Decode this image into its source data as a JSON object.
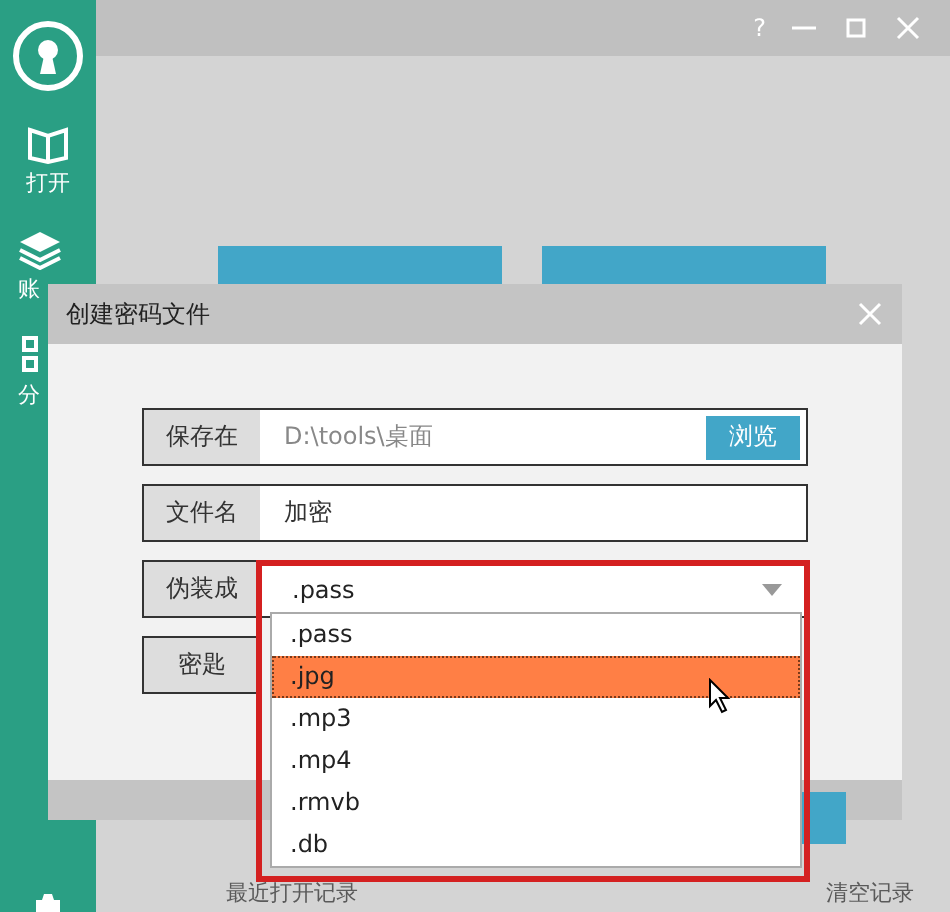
{
  "sidebar": {
    "items": [
      {
        "label": "打开"
      },
      {
        "label": "账"
      },
      {
        "label": "分"
      }
    ]
  },
  "title_bar": {
    "help": "?"
  },
  "bottom_links": [
    "最近打开记录",
    "清空记录"
  ],
  "dialog": {
    "title": "创建密码文件",
    "fields": [
      {
        "kind": "path",
        "label": "保存在",
        "value": "D:\\tools\\桌面",
        "button": "浏览"
      },
      {
        "kind": "text",
        "label": "文件名",
        "value": "加密"
      },
      {
        "kind": "select",
        "label": "伪装成",
        "value": ".pass"
      },
      {
        "kind": "key",
        "label": "密匙"
      }
    ],
    "dropdown": {
      "options": [
        {
          "label": ".pass",
          "selected": false
        },
        {
          "label": ".jpg",
          "selected": true
        },
        {
          "label": ".mp3",
          "selected": false
        },
        {
          "label": ".mp4",
          "selected": false
        },
        {
          "label": ".rmvb",
          "selected": false
        },
        {
          "label": ".db",
          "selected": false
        }
      ]
    }
  }
}
